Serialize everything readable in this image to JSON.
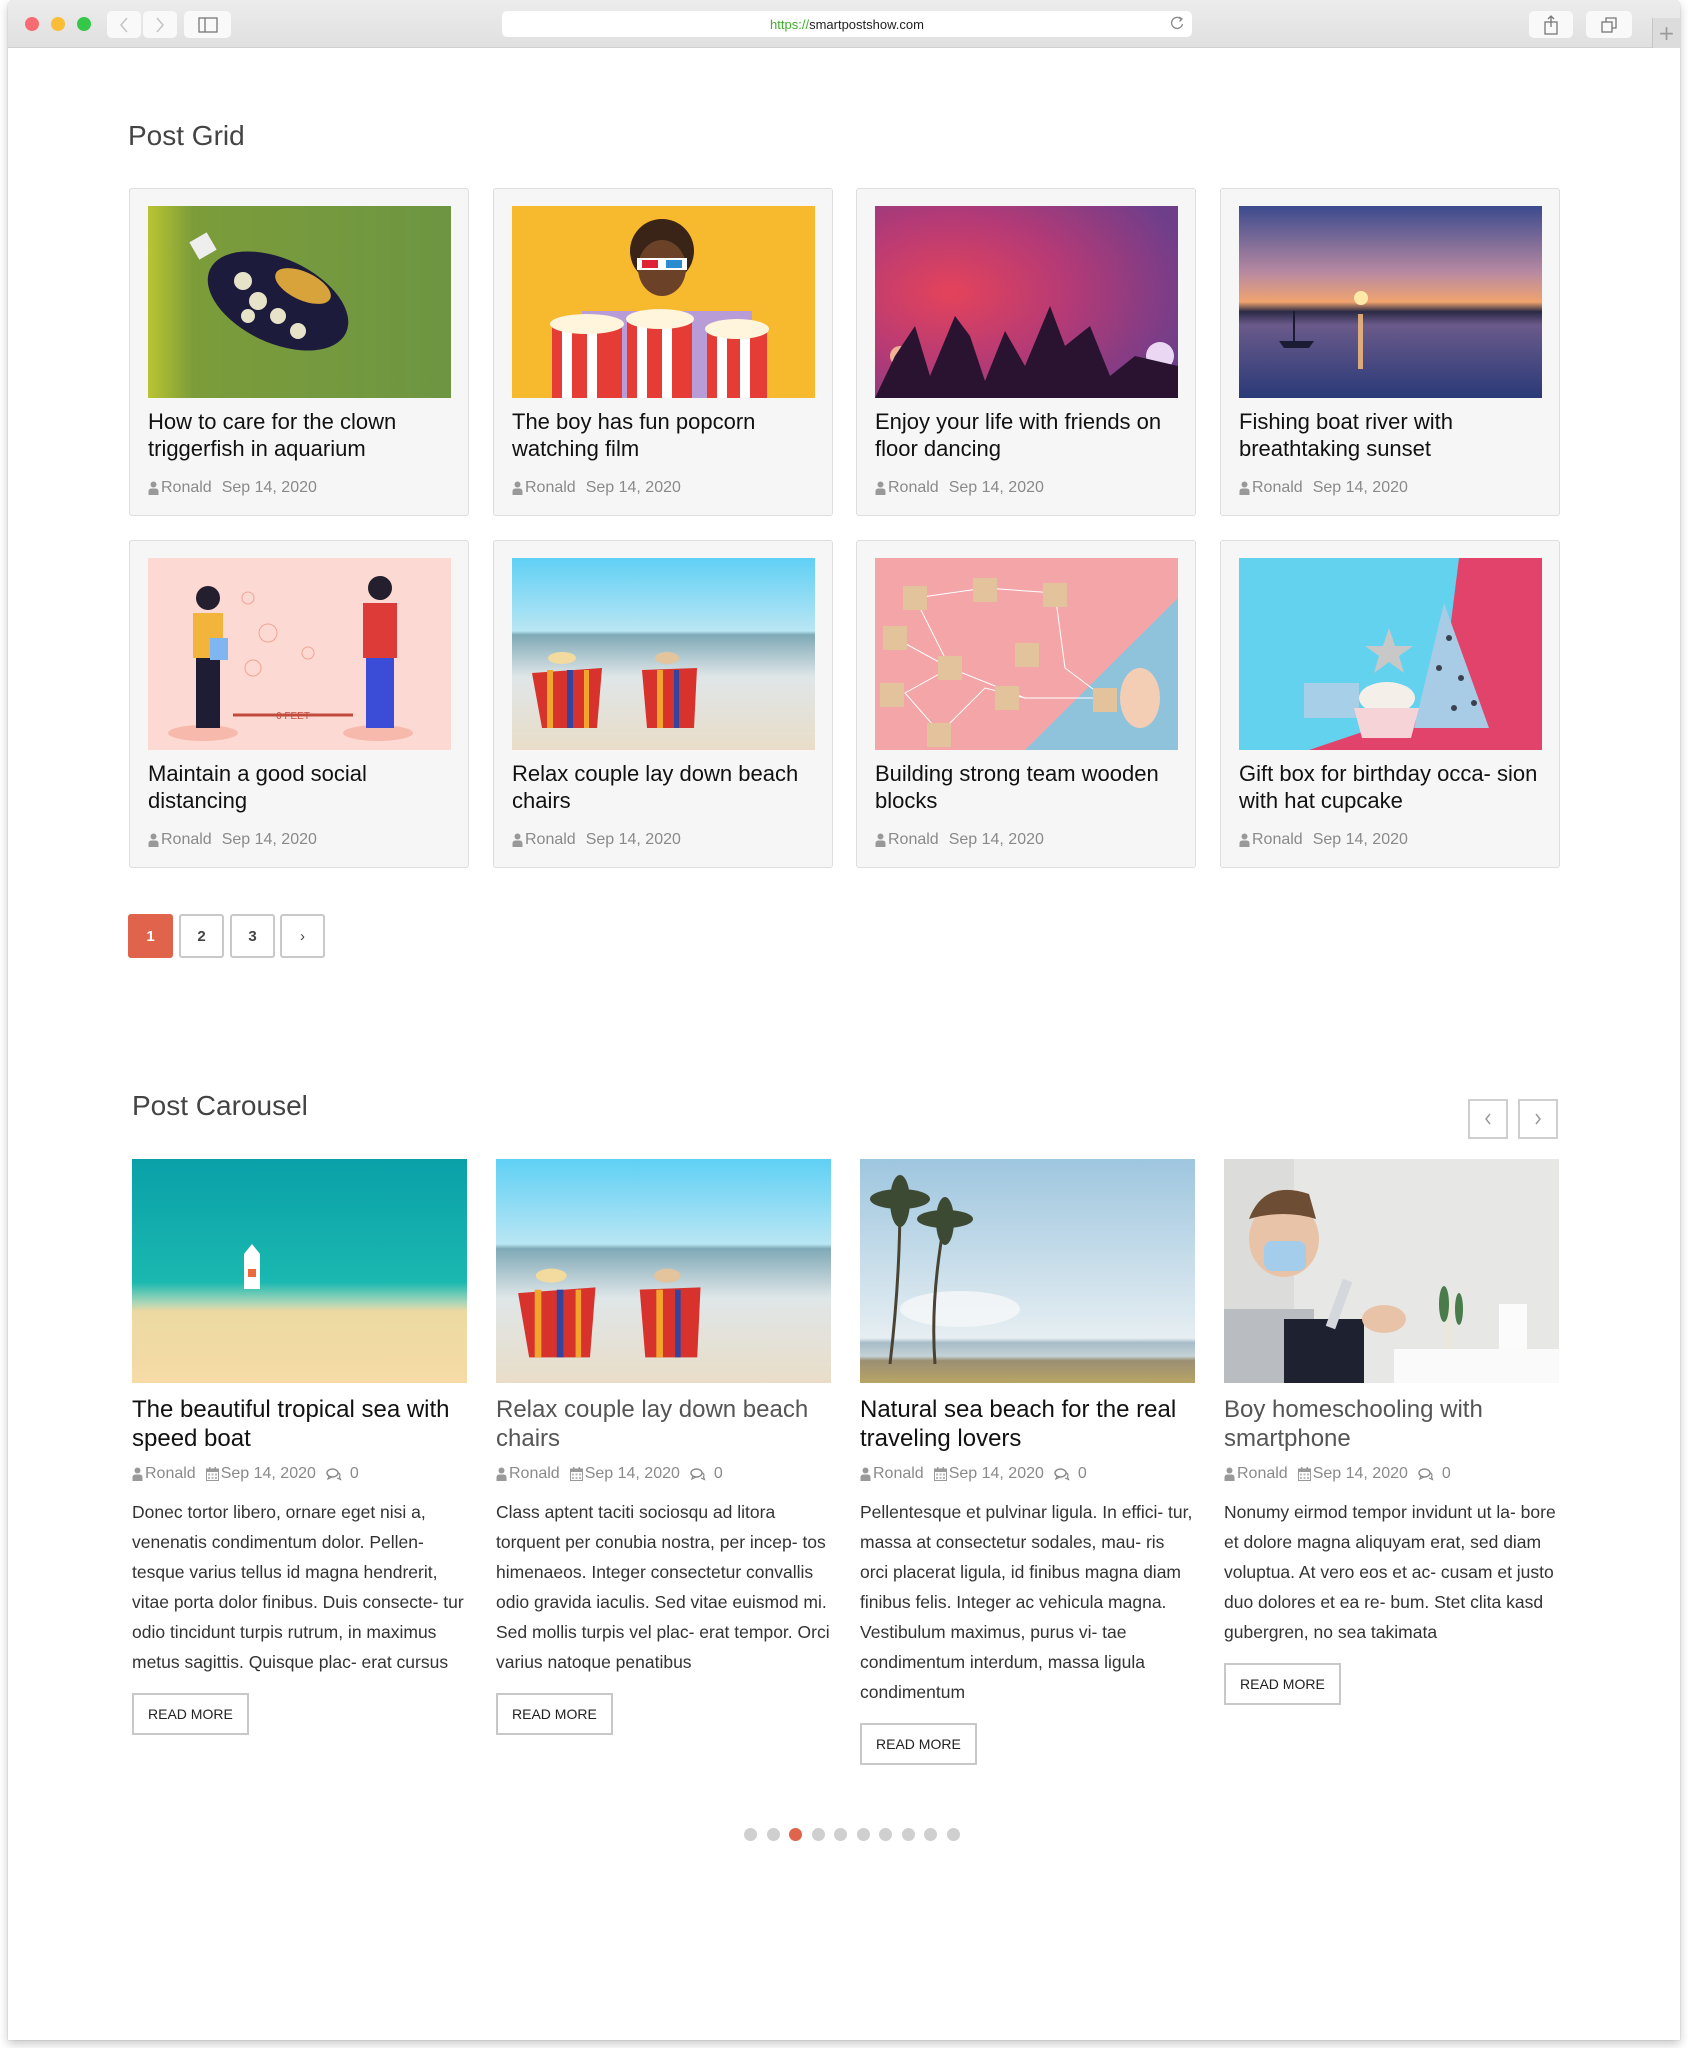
{
  "browser": {
    "url_scheme": "https://",
    "url_host": "smartpostshow.com",
    "reload_icon": "reload-icon",
    "new_tab_label": "+"
  },
  "grid": {
    "title": "Post Grid",
    "posts": [
      {
        "title": "How to care for the clown triggerfish in aquarium",
        "author": "Ronald",
        "date": "Sep 14, 2020",
        "image": "clown-triggerfish-photo"
      },
      {
        "title": "The boy has fun popcorn watching film",
        "author": "Ronald",
        "date": "Sep 14, 2020",
        "image": "popcorn-3d-glasses-photo"
      },
      {
        "title": "Enjoy your life with friends on floor dancing",
        "author": "Ronald",
        "date": "Sep 14, 2020",
        "image": "concert-crowd-photo"
      },
      {
        "title": "Fishing boat river with breathtaking sunset",
        "author": "Ronald",
        "date": "Sep 14, 2020",
        "image": "sunset-boat-photo"
      },
      {
        "title": "Maintain a good social distancing",
        "author": "Ronald",
        "date": "Sep 14, 2020",
        "image": "social-distancing-illustration"
      },
      {
        "title": "Relax couple lay down beach chairs",
        "author": "Ronald",
        "date": "Sep 14, 2020",
        "image": "beach-chairs-photo"
      },
      {
        "title": "Building strong team wooden blocks",
        "author": "Ronald",
        "date": "Sep 14, 2020",
        "image": "wooden-blocks-network-photo"
      },
      {
        "title": "Gift box for birthday occa- sion with hat cupcake",
        "author": "Ronald",
        "date": "Sep 14, 2020",
        "image": "birthday-cupcake-photo"
      }
    ],
    "pagination": {
      "pages": [
        "1",
        "2",
        "3"
      ],
      "current": "1",
      "next_label": "›"
    }
  },
  "carousel": {
    "title": "Post Carousel",
    "prev_label": "‹",
    "next_label": "›",
    "posts": [
      {
        "title": "The beautiful tropical sea with speed boat",
        "author": "Ronald",
        "date": "Sep 14, 2020",
        "comments": "0",
        "excerpt": "Donec tortor libero, ornare eget nisi a, venenatis condimentum dolor. Pellen- tesque varius tellus id magna hendrerit, vitae porta dolor finibus. Duis consecte- tur odio tincidunt turpis rutrum, in maximus metus sagittis. Quisque plac- erat cursus",
        "read_more": "READ MORE",
        "image": "tropical-sea-boat-photo"
      },
      {
        "title": "Relax couple lay down beach chairs",
        "author": "Ronald",
        "date": "Sep 14, 2020",
        "comments": "0",
        "excerpt": "Class aptent taciti sociosqu ad litora torquent per conubia nostra, per incep- tos himenaeos. Integer consectetur convallis odio gravida iaculis. Sed vitae euismod mi. Sed mollis turpis vel plac- erat tempor. Orci varius natoque penatibus",
        "read_more": "READ MORE",
        "image": "beach-chairs-photo"
      },
      {
        "title": "Natural sea beach for the real traveling lovers",
        "author": "Ronald",
        "date": "Sep 14, 2020",
        "comments": "0",
        "excerpt": "Pellentesque et pulvinar ligula. In effici- tur, massa at consectetur sodales, mau- ris orci placerat ligula, id finibus magna diam finibus felis. Integer ac vehicula magna. Vestibulum maximus, purus vi- tae condimentum interdum, massa ligula condimentum",
        "read_more": "READ MORE",
        "image": "palm-beach-photo"
      },
      {
        "title": "Boy homeschooling with smartphone",
        "author": "Ronald",
        "date": "Sep 14, 2020",
        "comments": "0",
        "excerpt": "Nonumy eirmod tempor invidunt ut la- bore et dolore magna aliquyam erat, sed diam voluptua. At vero eos et ac- cusam et justo duo dolores et ea re- bum. Stet clita kasd gubergren, no sea takimata",
        "read_more": "READ MORE",
        "image": "boy-mask-smartphone-photo"
      }
    ],
    "dots": {
      "count": 10,
      "active_index": 2
    }
  },
  "colors": {
    "accent": "#e0634b",
    "card_bg": "#f6f6f6",
    "dot_inactive": "#cfcfcf"
  }
}
